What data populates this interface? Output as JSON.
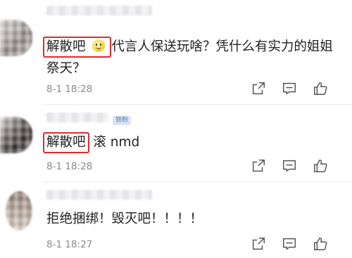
{
  "comments": [
    {
      "highlighted": "解散吧",
      "text_after_emoji": "代言人保送玩啥？凭什么有实力的姐姐",
      "text_line2": "祭天？",
      "time": "8-1 18:28",
      "badge": ""
    },
    {
      "highlighted": "解散吧",
      "text_after": "滚 nmd",
      "time": "8-1 18:28",
      "badge": "铁粉"
    },
    {
      "text": "拒绝捆绑！毁灭吧！！！！",
      "time": "8-1 18:27",
      "badge": ""
    }
  ],
  "icons": {
    "share": "share-icon",
    "comment": "comment-icon",
    "like": "like-icon"
  },
  "colors": {
    "highlight_border": "#e12b2b",
    "time_text": "#8a8a8a",
    "icon_gray": "#555555"
  }
}
